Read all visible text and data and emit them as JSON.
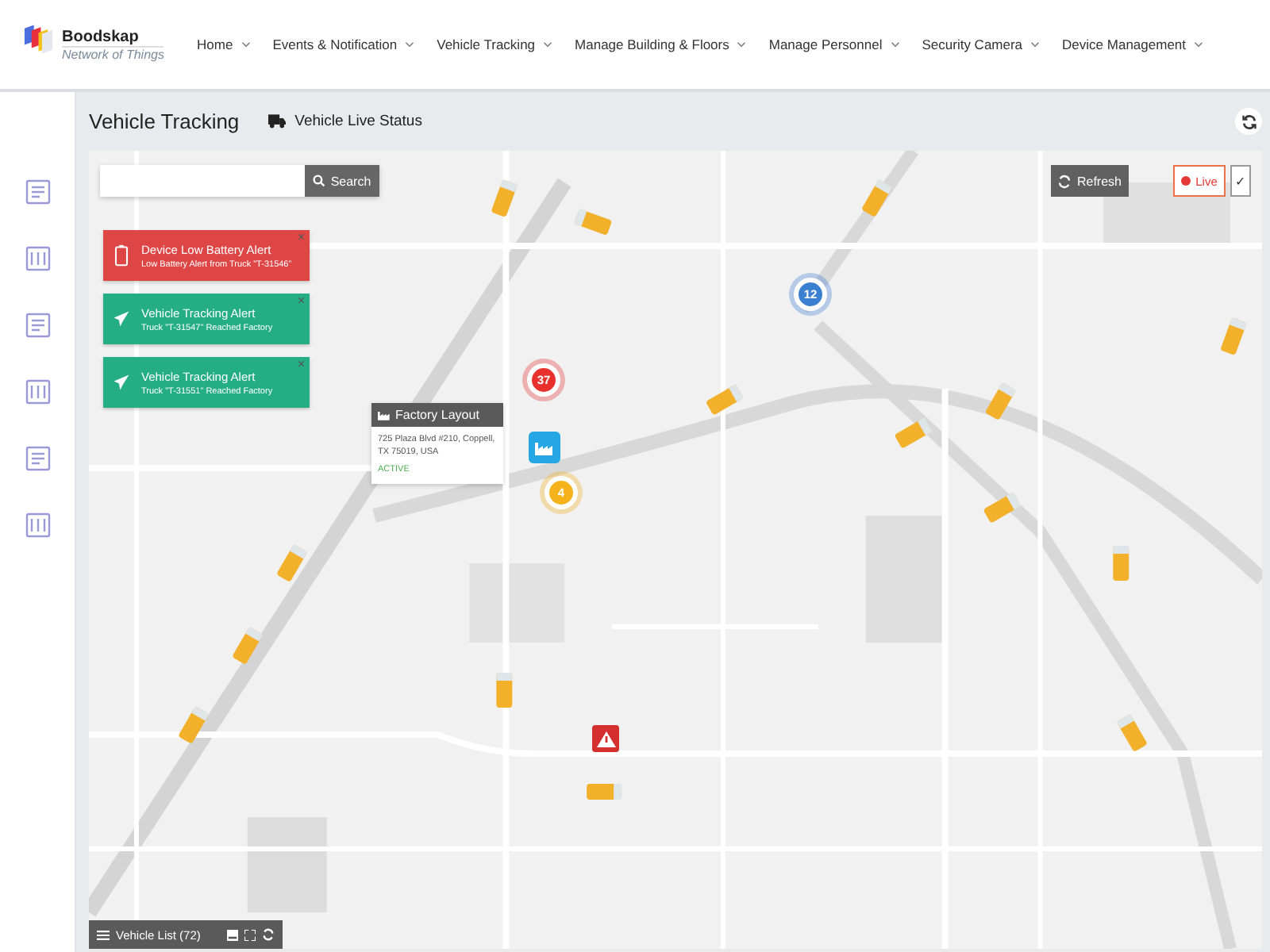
{
  "brand": {
    "name": "Boodskap",
    "tagline": "Network of Things"
  },
  "nav": [
    {
      "label": "Home"
    },
    {
      "label": "Events & Notification"
    },
    {
      "label": "Vehicle Tracking"
    },
    {
      "label": "Manage Building & Floors"
    },
    {
      "label": "Manage Personnel"
    },
    {
      "label": "Security Camera"
    },
    {
      "label": "Device Management"
    }
  ],
  "page": {
    "title": "Vehicle Tracking",
    "subtitle": "Vehicle Live Status"
  },
  "search": {
    "button": "Search"
  },
  "controls": {
    "refresh": "Refresh",
    "live": "Live",
    "live_on": true,
    "check": "✓"
  },
  "alerts": [
    {
      "kind": "battery",
      "title": "Device Low Battery Alert",
      "message": "Low Battery Alert from Truck \"T-31546\"",
      "close": "×"
    },
    {
      "kind": "tracking",
      "title": "Vehicle Tracking Alert",
      "message": "Truck \"T-31547\" Reached Factory",
      "close": "×"
    },
    {
      "kind": "tracking",
      "title": "Vehicle Tracking Alert",
      "message": "Truck \"T-31551\" Reached Factory",
      "close": "×"
    }
  ],
  "popup": {
    "title": "Factory Layout",
    "address": "725 Plaza Blvd #210, Coppell, TX 75019, USA",
    "status": "ACTIVE"
  },
  "clusters": [
    {
      "count": "37",
      "color": "#e8302c"
    },
    {
      "count": "4",
      "color": "#f5b21b"
    },
    {
      "count": "12",
      "color": "#3b7fd1"
    }
  ],
  "vehicle_list": {
    "label": "Vehicle List (72)"
  }
}
